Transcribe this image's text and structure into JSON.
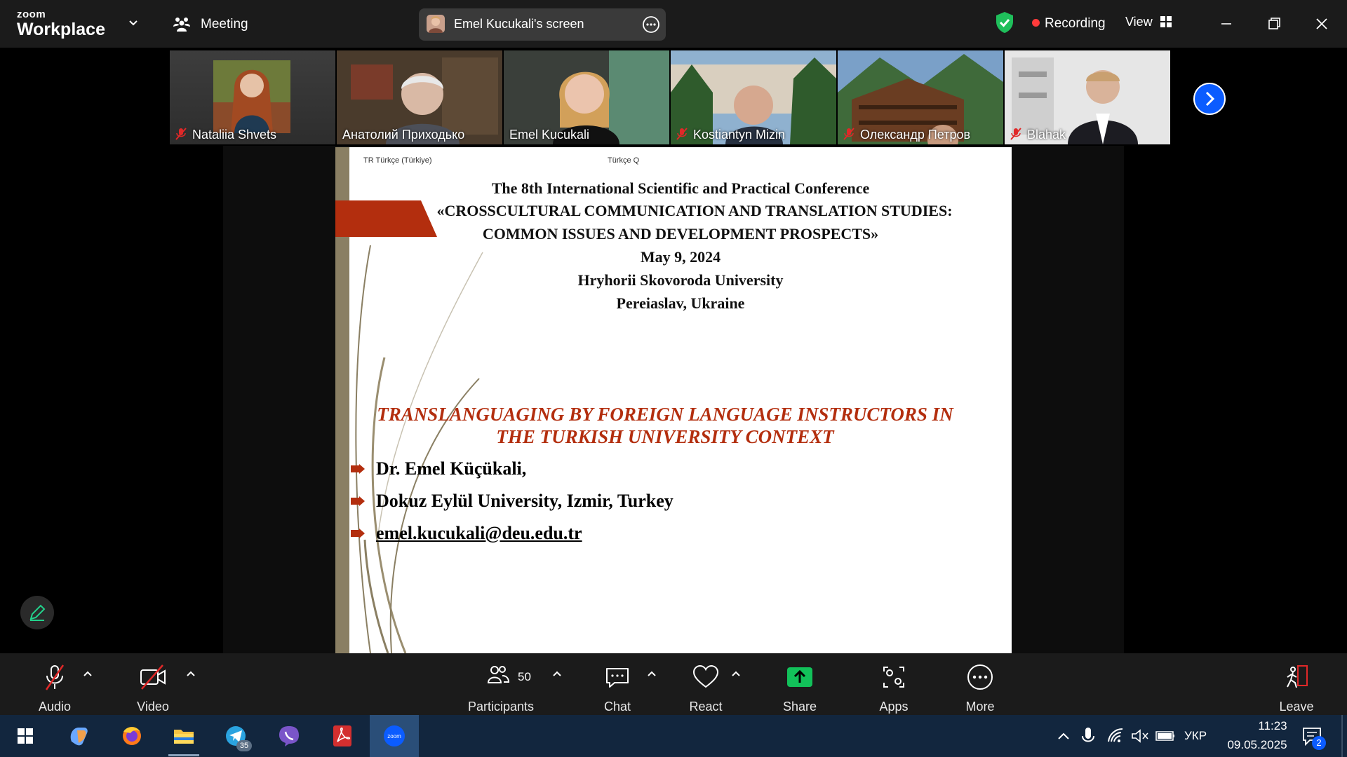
{
  "topbar": {
    "logo_small": "zoom",
    "logo_big": "Workplace",
    "meeting_label": "Meeting",
    "screen_label": "Emel Kucukali's screen",
    "recording_label": "Recording",
    "view_label": "View"
  },
  "participants": [
    {
      "name": "Nataliia Shvets",
      "muted": true
    },
    {
      "name": "Анатолий Приходько",
      "muted": false
    },
    {
      "name": "Emel Kucukali",
      "muted": false,
      "active": true
    },
    {
      "name": "Kostiantyn Mizin",
      "muted": true
    },
    {
      "name": "Олександр Петров",
      "muted": true
    },
    {
      "name": "Blahak",
      "muted": true
    }
  ],
  "slide": {
    "lang_bar_left": "TR Türkçe (Türkiye)",
    "lang_bar_right": "Türkçe Q",
    "line1": "The 8th International Scientific and Practical Conference",
    "line2": "«CROSSCULTURAL COMMUNICATION AND TRANSLATION STUDIES:",
    "line3": "COMMON ISSUES AND DEVELOPMENT PROSPECTS»",
    "line4": "May 9, 2024",
    "line5": "Hryhorii Skovoroda University",
    "line6": "Pereiaslav, Ukraine",
    "talk_title1": "TRANSLANGUAGING BY FOREIGN LANGUAGE INSTRUCTORS IN",
    "talk_title2": "THE TURKISH UNIVERSITY CONTEXT",
    "bullets": [
      "Dr. Emel Küçükali,",
      "Dokuz Eylül University, Izmir, Turkey",
      "emel.kucukali@deu.edu.tr"
    ]
  },
  "toolbar": {
    "audio": "Audio",
    "video": "Video",
    "participants": "Participants",
    "participants_count": "50",
    "chat": "Chat",
    "react": "React",
    "share": "Share",
    "apps": "Apps",
    "more": "More",
    "leave": "Leave"
  },
  "taskbar": {
    "telegram_badge": "35",
    "lang": "УКР",
    "time": "11:23",
    "date": "09.05.2025",
    "notif_count": "2"
  },
  "colors": {
    "accent_blue": "#0b5cff",
    "share_green": "#12c15a",
    "active_outline": "#23d18b",
    "slide_title_red": "#b32e0e",
    "leave_red": "#e02828"
  }
}
